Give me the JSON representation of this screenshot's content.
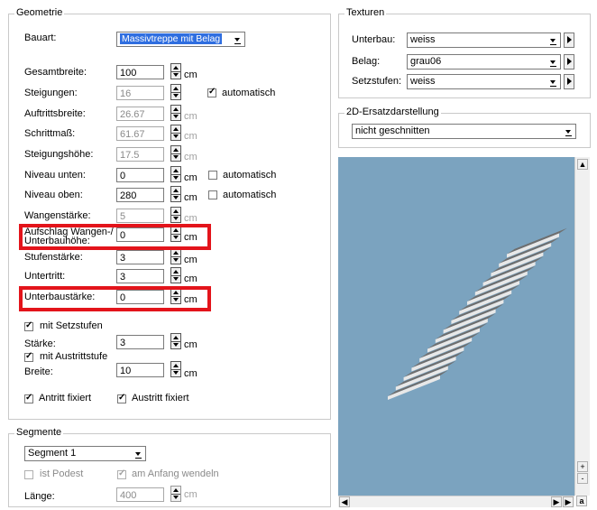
{
  "geometrie": {
    "title": "Geometrie",
    "bauart_label": "Bauart:",
    "bauart_value": "Massivtreppe mit Belag",
    "rows": [
      {
        "label": "Gesamtbreite:",
        "value": "100",
        "unit": "cm",
        "disabled": false
      },
      {
        "label": "Steigungen:",
        "value": "16",
        "unit": "",
        "disabled": true,
        "checkbox": "automatisch",
        "checked": true
      },
      {
        "label": "Auftrittsbreite:",
        "value": "26.67",
        "unit": "cm",
        "disabled": true
      },
      {
        "label": "Schrittmaß:",
        "value": "61.67",
        "unit": "cm",
        "disabled": true
      },
      {
        "label": "Steigungshöhe:",
        "value": "17.5",
        "unit": "cm",
        "disabled": true
      },
      {
        "label": "Niveau unten:",
        "value": "0",
        "unit": "cm",
        "disabled": false,
        "checkbox": "automatisch",
        "checked": false
      },
      {
        "label": "Niveau oben:",
        "value": "280",
        "unit": "cm",
        "disabled": false,
        "checkbox": "automatisch",
        "checked": false
      },
      {
        "label": "Wangenstärke:",
        "value": "5",
        "unit": "cm",
        "disabled": true
      },
      {
        "label": "Aufschlag Wangen-/ Unterbauhöhe:",
        "value": "0",
        "unit": "cm",
        "disabled": false
      },
      {
        "label": "Stufenstärke:",
        "value": "3",
        "unit": "cm",
        "disabled": false
      },
      {
        "label": "Untertritt:",
        "value": "3",
        "unit": "cm",
        "disabled": false
      },
      {
        "label": "Unterbaustärke:",
        "value": "0",
        "unit": "cm",
        "disabled": false
      }
    ],
    "mit_setzstufen_label": "mit Setzstufen",
    "staerke_label": "Stärke:",
    "staerke_value": "3",
    "staerke_unit": "cm",
    "mit_austrittstufe_label": "mit Austrittstufe",
    "breite_label": "Breite:",
    "breite_value": "10",
    "breite_unit": "cm",
    "antritt_label": "Antritt fixiert",
    "austritt_label": "Austritt fixiert"
  },
  "segmente": {
    "title": "Segmente",
    "segment_value": "Segment 1",
    "ist_podest_label": "ist Podest",
    "am_anfang_label": "am Anfang wendeln",
    "laenge_label": "Länge:",
    "laenge_value": "400",
    "laenge_unit": "cm"
  },
  "texturen": {
    "title": "Texturen",
    "unterbau_label": "Unterbau:",
    "unterbau_value": "weiss",
    "belag_label": "Belag:",
    "belag_value": "grau06",
    "setzstufen_label": "Setzstufen:",
    "setzstufen_value": "weiss"
  },
  "ersatz": {
    "title": "2D-Ersatzdarstellung",
    "value": "nicht geschnitten"
  },
  "scroll": {
    "plus": "+",
    "minus": "-",
    "a": "a"
  },
  "colors": {
    "preview_bg": "#7ba3bf",
    "highlight": "#e3141b",
    "selection": "#2f6ee0"
  }
}
